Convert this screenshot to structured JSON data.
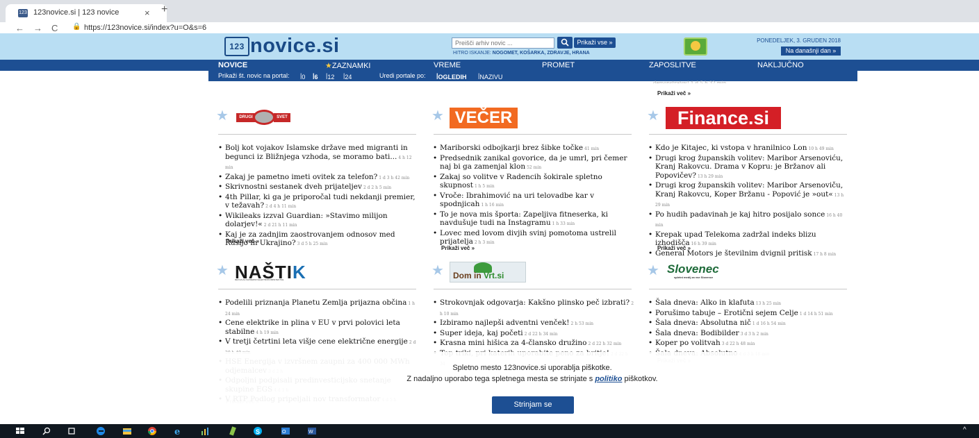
{
  "browser": {
    "tab_title": "123novice.si | 123 novice",
    "tab_close": "×",
    "new_tab": "+",
    "back": "←",
    "forward": "→",
    "reload": "C",
    "lock": "🔒",
    "url": "https://123novice.si/index?u=O&s=6"
  },
  "header": {
    "logo_text": "novice.si",
    "logo_box": "123",
    "search_placeholder": "Preišči arhiv novic ...",
    "search_icon": "magnifier-icon",
    "archive_button": "Prikaži vse »",
    "quick_search_label": "HITRO ISKANJE:",
    "quick_search_links": "NOGOMET, KOŠARKA, ZDRAVJE, HRANA",
    "date": "PONEDELJEK, 3. GRUDEN 2018",
    "today_button": "Na današnji dan »"
  },
  "nav": {
    "items": [
      "NOVICE",
      "ZAZNAMKI",
      "VREME",
      "PROMET",
      "ZAPOSLITVE",
      "NAKLJUČNO"
    ],
    "star": "★"
  },
  "subnav": {
    "count_label": "Prikaži št. novic na portal:",
    "counts": [
      "0",
      "6",
      "12",
      "24"
    ],
    "arrange_label": "Uredi portale po:",
    "arrange_options": [
      "OGLEDIH",
      "NAZIVU"
    ]
  },
  "content": {
    "top_stub": "demonstratov! 1 d 5 h 32 min",
    "top_more": "Prikaži več »",
    "more": "Prikaži več »",
    "star": "★",
    "logos": {
      "drugi_svet": [
        "DRUGI",
        "SVET"
      ],
      "vecer": "VEČER",
      "finance": "Finance.si",
      "nastik_a": "NAŠTI",
      "nastik_b": "K",
      "nastik_sub": "REVIJA ZA NAPREDNO ELEKTROKOMPETENTNE",
      "domvrt_a": "Dom in ",
      "domvrt_b": "Vrt.si",
      "slovenec": "Slovenec",
      "slovenec_sub": "spletni medij za vse Slovence"
    },
    "drugi_svet": [
      {
        "t": "Bolj kot vojakov Islamske države med migranti in begunci iz Bližnjega vzhoda, se moramo bati...",
        "d": "4 h 12 min"
      },
      {
        "t": "Zakaj je pametno imeti ovitek za telefon?",
        "d": "1 d 3 h 42 min"
      },
      {
        "t": "Skrivnostni sestanek dveh prijateljev",
        "d": "2 d 2 h 5 min"
      },
      {
        "t": "4th Pillar, ki ga je priporočal tudi nekdanji premier, v težavah?",
        "d": "2 d 4 h 11 min"
      },
      {
        "t": "Wikileaks izzval Guardian: »Stavimo milijon dolarjev!«",
        "d": "2 d 21 h 11 min"
      },
      {
        "t": "Kaj je za zadnjim zaostrovanjem odnosov med Rusijo in Ukrajino?",
        "d": "3 d 5 h 25 min"
      }
    ],
    "vecer": [
      {
        "t": "Mariborski odbojkarji brez šibke točke",
        "d": "41 min"
      },
      {
        "t": "Predsednik zanikal govorice, da je umrl, pri čemer naj bi ga zamenjal klon",
        "d": "52 min"
      },
      {
        "t": "Zakaj so volitve v Radencih šokirale spletno skupnost",
        "d": "1 h 5 min"
      },
      {
        "t": "Vroče: Ibrahimović na uri telovadbe kar v spodnjicah",
        "d": "1 h 16 min"
      },
      {
        "t": "To je nova mis športa: Zapeljiva fitneserka, ki navdušuje tudi na Instagramu",
        "d": "1 h 33 min"
      },
      {
        "t": "Lovec med lovom divjih svinj pomotoma ustrelil prijatelja",
        "d": "2 h 3 min"
      }
    ],
    "finance": [
      {
        "t": "Kdo je Kitajec, ki vstopa v hranilnico Lon",
        "d": "10 h 49 min"
      },
      {
        "t": "Drugi krog županskih volitev: Maribor Arsenoviću, Kranj Rakovcu. Drama v Kopru: je Bržanov ali Popovičev?",
        "d": "13 h 29 min"
      },
      {
        "t": "Drugi krog županskih volitev: Maribor Arsenoviču, Kranj Rakovcu, Koper Bržanu - Popović je »out«",
        "d": "13 h 29 min"
      },
      {
        "t": "Po hudih padavinah je kaj hitro posijalo sonce",
        "d": "16 h 40 min"
      },
      {
        "t": "Krepak upad Telekoma zadržal indeks blizu izhodišča",
        "d": "16 h 39 min"
      },
      {
        "t": "General Motors je številnim dvignil pritisk",
        "d": "17 h 8 min"
      }
    ],
    "nastik": [
      {
        "t": "Podelili priznanja Planetu Zemlja prijazna občina",
        "d": "1 h 24 min"
      },
      {
        "t": "Cene elektrike in plina v EU v prvi polovici leta stabilne",
        "d": "4 h 19 min"
      },
      {
        "t": "V tretji četrtini leta višje cene električne energije",
        "d": "2 d 20 h 49 min"
      },
      {
        "t": "HSE Energija v izvršnem zaupni za 400 000 MWh odjemalcev",
        "d": "3 d 2 h"
      },
      {
        "t": "Odpoljni podpisali predinvesticijsko snetanje skupine EGS",
        "d": "4 d 1 h"
      },
      {
        "t": "V RTP Podlog pripeljali nov transformator",
        "d": "4 d 5 h"
      }
    ],
    "domvrt": [
      {
        "t": "Strokovnjak odgovarja: Kakšno plinsko peč izbrati?",
        "d": "2 h 10 min"
      },
      {
        "t": "Izbiramo najlepši adventni venček!",
        "d": "2 h 53 min"
      },
      {
        "t": "Super ideja, kaj početi",
        "d": "2 d 22 h 34 min"
      },
      {
        "t": "Krasna mini hišica za 4-člansko družino",
        "d": "2 d 22 h 32 min"
      },
      {
        "t": "Top triki, pri katerih uporabite peno za britje!",
        "d": "2 d 22 h 34"
      }
    ],
    "slovenec": [
      {
        "t": "Šala dneva: Alko in klafuta",
        "d": "13 h 25 min"
      },
      {
        "t": "Porušimo tabuje – Erotični sejem Celje",
        "d": "1 d 14 h 51 min"
      },
      {
        "t": "Šala dneva: Absolutna nič",
        "d": "1 d 16 h 54 min"
      },
      {
        "t": "Šala dneva: Bodibilder",
        "d": "3 d 3 h 2 min"
      },
      {
        "t": "Koper po volitvah",
        "d": "3 d 22 h 48 min"
      },
      {
        "t": "Šala dneva: Absolutno",
        "d": "4 d 3 h 18 min"
      }
    ]
  },
  "cookie": {
    "line1": "Spletno mesto 123novice.si uporablja piškotke.",
    "line2_a": "Z nadaljno uporabo tega spletnega mesta se strinjate s ",
    "line2_link": "politiko",
    "line2_b": " piškotkov.",
    "accept": "Strinjam se"
  },
  "colors": {
    "header_bg": "#b9def3",
    "nav_bg": "#1d4f93",
    "vecer": "#f26a21",
    "finance": "#d41f26"
  }
}
